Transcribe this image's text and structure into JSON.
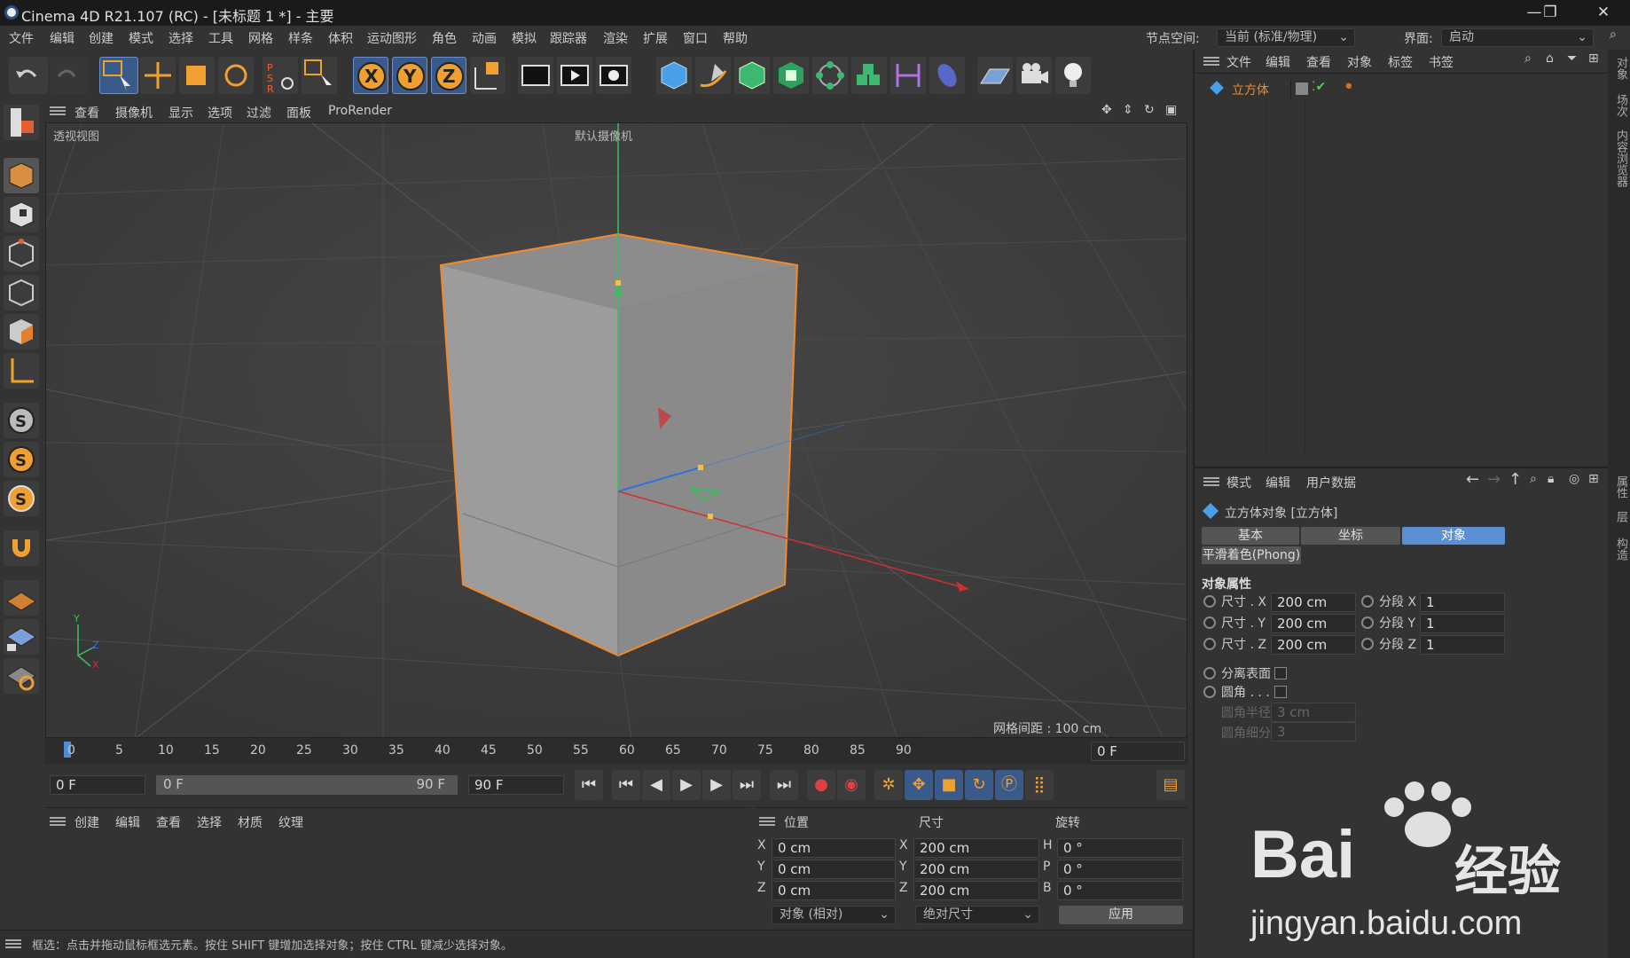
{
  "title": {
    "app": "Cinema 4D R21.107 (RC) - [未标题 1 *] - 主要",
    "min": "—",
    "max": "❐",
    "close": "✕"
  },
  "menu": [
    "文件",
    "编辑",
    "创建",
    "模式",
    "选择",
    "工具",
    "网格",
    "样条",
    "体积",
    "运动图形",
    "角色",
    "动画",
    "模拟",
    "跟踪器",
    "渲染",
    "扩展",
    "窗口",
    "帮助"
  ],
  "nodespace": {
    "label": "节点空间:",
    "value": "当前 (标准/物理)"
  },
  "layout": {
    "label": "界面:",
    "value": "启动"
  },
  "viewport": {
    "menu": [
      "查看",
      "摄像机",
      "显示",
      "选项",
      "过滤",
      "面板",
      "ProRender"
    ],
    "view_name": "透视视图",
    "camera": "默认摄像机",
    "grid": "网格间距 : 100 cm"
  },
  "timeline": {
    "ticks": [
      "0",
      "5",
      "10",
      "15",
      "20",
      "25",
      "30",
      "35",
      "40",
      "45",
      "50",
      "55",
      "60",
      "65",
      "70",
      "75",
      "80",
      "85",
      "90"
    ],
    "current": "0 F"
  },
  "transport": {
    "start": "0 F",
    "range_start": "0 F",
    "range_end": "90 F",
    "end": "90 F"
  },
  "matmgr": {
    "menu": [
      "创建",
      "编辑",
      "查看",
      "选择",
      "材质",
      "纹理"
    ]
  },
  "coords": {
    "headers": [
      "位置",
      "尺寸",
      "旋转"
    ],
    "rows": [
      {
        "a": "X",
        "pos": "0 cm",
        "b": "X",
        "size": "200 cm",
        "c": "H",
        "rot": "0 °"
      },
      {
        "a": "Y",
        "pos": "0 cm",
        "b": "Y",
        "size": "200 cm",
        "c": "P",
        "rot": "0 °"
      },
      {
        "a": "Z",
        "pos": "0 cm",
        "b": "Z",
        "size": "200 cm",
        "c": "B",
        "rot": "0 °"
      }
    ],
    "mode": "对象 (相对)",
    "sizemode": "绝对尺寸",
    "apply": "应用"
  },
  "status": "框选：点击并拖动鼠标框选元素。按住 SHIFT 键增加选择对象；按住 CTRL 键减少选择对象。",
  "objmgr": {
    "menu": [
      "文件",
      "编辑",
      "查看",
      "对象",
      "标签",
      "书签"
    ],
    "object": "立方体"
  },
  "attr": {
    "menu": [
      "模式",
      "编辑",
      "用户数据"
    ],
    "title": "立方体对象 [立方体]",
    "tabs": [
      "基本",
      "坐标",
      "对象"
    ],
    "phong": "平滑着色(Phong)",
    "section": "对象属性",
    "size": [
      {
        "l": "尺寸 . X",
        "v": "200 cm"
      },
      {
        "l": "尺寸 . Y",
        "v": "200 cm"
      },
      {
        "l": "尺寸 . Z",
        "v": "200 cm"
      }
    ],
    "seg": [
      {
        "l": "分段 X",
        "v": "1"
      },
      {
        "l": "分段 Y",
        "v": "1"
      },
      {
        "l": "分段 Z",
        "v": "1"
      }
    ],
    "sep": "分离表面",
    "fillet": "圆角 . . .",
    "fr": "圆角半径",
    "frv": "3 cm",
    "fs": "圆角细分",
    "fsv": "3"
  },
  "rightstrip": [
    "对象",
    "场次",
    "内容浏览器",
    "属性",
    "层",
    "构造"
  ],
  "watermark": {
    "brand1": "Bai",
    "brand2": "经验",
    "url": "jingyan.baidu.com"
  },
  "colors": {
    "accent": "#5b8fd3",
    "selection": "#f28a2a"
  }
}
